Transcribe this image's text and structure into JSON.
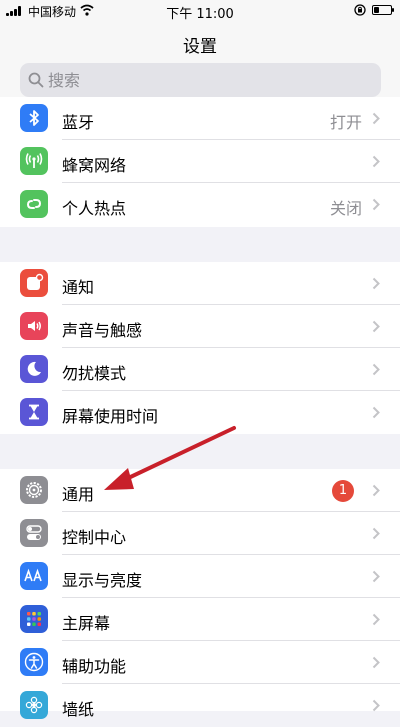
{
  "status_bar": {
    "carrier": "中国移动",
    "time": "下午 11:00"
  },
  "header": {
    "title": "设置",
    "search_placeholder": "搜索"
  },
  "groups": [
    {
      "items": [
        {
          "label": "蓝牙",
          "detail": "打开",
          "icon": "bluetooth-icon",
          "color": "#2f7cf6"
        },
        {
          "label": "蜂窝网络",
          "detail": "",
          "icon": "cellular-icon",
          "color": "#53c35e"
        },
        {
          "label": "个人热点",
          "detail": "关闭",
          "icon": "hotspot-icon",
          "color": "#53c35e"
        }
      ]
    },
    {
      "items": [
        {
          "label": "通知",
          "detail": "",
          "icon": "notifications-icon",
          "color": "#eb4e3d"
        },
        {
          "label": "声音与触感",
          "detail": "",
          "icon": "sound-icon",
          "color": "#e8445a"
        },
        {
          "label": "勿扰模式",
          "detail": "",
          "icon": "moon-icon",
          "color": "#5a56d6"
        },
        {
          "label": "屏幕使用时间",
          "detail": "",
          "icon": "hourglass-icon",
          "color": "#5a56d6"
        }
      ]
    },
    {
      "items": [
        {
          "label": "通用",
          "detail": "",
          "badge": "1",
          "icon": "gear-icon",
          "color": "#8e8e93"
        },
        {
          "label": "控制中心",
          "detail": "",
          "icon": "toggles-icon",
          "color": "#8e8e93"
        },
        {
          "label": "显示与亮度",
          "detail": "",
          "icon": "display-icon",
          "color": "#2f7cf6"
        },
        {
          "label": "主屏幕",
          "detail": "",
          "icon": "home-screen-icon",
          "color": "#2f5fd8"
        },
        {
          "label": "辅助功能",
          "detail": "",
          "icon": "accessibility-icon",
          "color": "#2f7cf6"
        },
        {
          "label": "墙纸",
          "detail": "",
          "icon": "wallpaper-icon",
          "color": "#35a8d8"
        }
      ]
    }
  ],
  "annotation": {
    "arrow_color": "#c8202a"
  }
}
